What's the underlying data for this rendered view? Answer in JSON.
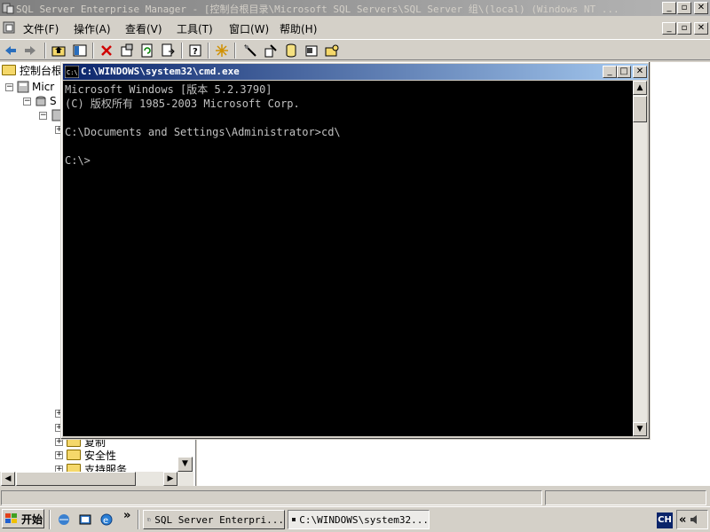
{
  "main_window": {
    "title": "SQL Server Enterprise Manager - [控制台根目录\\Microsoft SQL Servers\\SQL Server 组\\(local) (Windows NT ..."
  },
  "menu": {
    "items": [
      "文件(F)",
      "操作(A)",
      "查看(V)",
      "工具(T)",
      "窗口(W)",
      "帮助(H)"
    ]
  },
  "tree": {
    "root_label": "控制台根",
    "item_micro": "Micr",
    "item_s": "S",
    "item_copy": "复制",
    "item_security": "安全性",
    "item_support": "支持服务"
  },
  "cmd": {
    "title": "C:\\WINDOWS\\system32\\cmd.exe",
    "lines": [
      "Microsoft Windows [版本 5.2.3790]",
      "(C) 版权所有 1985-2003 Microsoft Corp.",
      "",
      "C:\\Documents and Settings\\Administrator>cd\\",
      "",
      "C:\\>"
    ]
  },
  "taskbar": {
    "start_label": "开始",
    "chevron": "»",
    "tasks": [
      "SQL Server Enterpri...",
      "C:\\WINDOWS\\system32..."
    ],
    "lang": "CH",
    "tray_chevron": "«"
  },
  "colors": {
    "cmd_title_active": "#0a246a",
    "main_title_inactive": "#808080",
    "cmd_background": "#000000",
    "cmd_text": "#c0c0c0"
  }
}
